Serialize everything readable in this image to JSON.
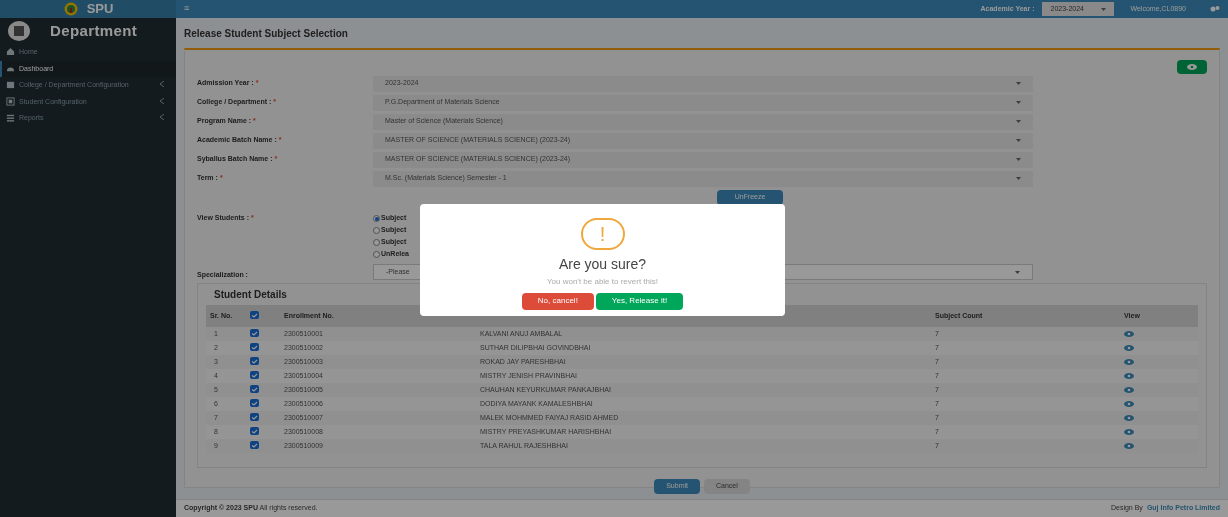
{
  "brand": {
    "name": "SPU"
  },
  "sidebar": {
    "title": "Department",
    "items": [
      {
        "label": "Home",
        "selected": false,
        "expandable": false
      },
      {
        "label": "Dashboard",
        "selected": true,
        "expandable": false
      },
      {
        "label": "College / Department Configuration",
        "selected": false,
        "expandable": true
      },
      {
        "label": "Student Configuration",
        "selected": false,
        "expandable": true
      },
      {
        "label": "Reports",
        "selected": false,
        "expandable": true
      }
    ]
  },
  "topbar": {
    "menu_icon": "≡",
    "academic_year_label": "Academic Year :",
    "academic_year": "2023-2024",
    "welcome": "Welcome,CL0890"
  },
  "page_title": "Release Student Subject Selection",
  "form": {
    "required_mark": "*",
    "fields": [
      {
        "label": "Admission Year :",
        "required": true,
        "value": "2023-2024"
      },
      {
        "label": "College / Department :",
        "required": true,
        "value": "P.G.Department of Materials Science"
      },
      {
        "label": "Program Name :",
        "required": true,
        "value": "Master of Science (Materials Science)"
      },
      {
        "label": "Academic Batch Name :",
        "required": true,
        "value": "MASTER OF SCIENCE (MATERIALS SCIENCE) (2023-24)"
      },
      {
        "label": "Syballus Batch Name :",
        "required": true,
        "value": "MASTER OF SCIENCE (MATERIALS SCIENCE) (2023-24)"
      },
      {
        "label": "Term :",
        "required": true,
        "value": "M.Sc. (Materials Science) Semester - 1"
      }
    ],
    "unfreeze_button": "UnFreeze",
    "view_students": {
      "label": "View Students :",
      "required": true,
      "options": [
        {
          "label": "Subject",
          "selected": true
        },
        {
          "label": "Subject",
          "selected": false
        },
        {
          "label": "Subject",
          "selected": false
        },
        {
          "label": "UnRelea",
          "selected": false
        }
      ]
    },
    "specialization": {
      "label": "Specialization :",
      "value": "-Please"
    }
  },
  "student_details": {
    "title": "Student Details",
    "columns": [
      "Sr. No.",
      "Enrollment No.",
      "Subject Count",
      "View"
    ],
    "header_checked": true,
    "rows": [
      {
        "sr": "1",
        "checked": true,
        "enrollment": "2300510001",
        "name": "KALVANI ANUJ AMBALAL",
        "subject_count": "7"
      },
      {
        "sr": "2",
        "checked": true,
        "enrollment": "2300510002",
        "name": "SUTHAR DILIPBHAI GOVINDBHAI",
        "subject_count": "7"
      },
      {
        "sr": "3",
        "checked": true,
        "enrollment": "2300510003",
        "name": "ROKAD JAY PARESHBHAI",
        "subject_count": "7"
      },
      {
        "sr": "4",
        "checked": true,
        "enrollment": "2300510004",
        "name": "MISTRY JENISH PRAVINBHAI",
        "subject_count": "7"
      },
      {
        "sr": "5",
        "checked": true,
        "enrollment": "2300510005",
        "name": "CHAUHAN KEYURKUMAR PANKAJBHAI",
        "subject_count": "7"
      },
      {
        "sr": "6",
        "checked": true,
        "enrollment": "2300510006",
        "name": "DODIYA MAYANK KAMALESHBHAI",
        "subject_count": "7"
      },
      {
        "sr": "7",
        "checked": true,
        "enrollment": "2300510007",
        "name": "MALEK MOHMMED FAIYAJ RASID AHMED",
        "subject_count": "7"
      },
      {
        "sr": "8",
        "checked": true,
        "enrollment": "2300510008",
        "name": "MISTRY PREYASHKUMAR HARISHBHAI",
        "subject_count": "7"
      },
      {
        "sr": "9",
        "checked": true,
        "enrollment": "2300510009",
        "name": "TALA RAHUL RAJESHBHAI",
        "subject_count": "7"
      }
    ]
  },
  "actions": [
    "Submit",
    "Cancel"
  ],
  "footer": {
    "copyright": "**Copyright © 2023 SPU** All rights reserved.",
    "design_by": "Design By",
    "designer": "Guj Info Petro Limited"
  },
  "dialog": {
    "icon": "!",
    "title": "Are you sure?",
    "text": "You won't be able to revert this!",
    "buttons": [
      {
        "label": "No, cancel!",
        "kind": "cancel"
      },
      {
        "label": "Yes, Release it!",
        "kind": "confirm"
      }
    ]
  }
}
